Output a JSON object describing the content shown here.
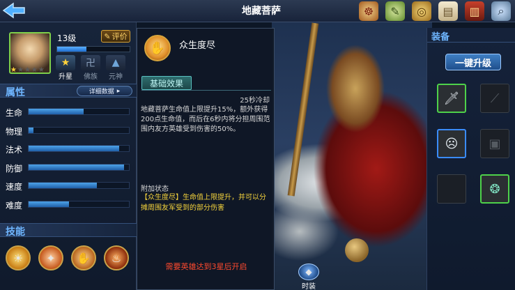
{
  "header": {
    "title": "地藏菩萨",
    "back_icon": "back-arrow-icon",
    "top_icons": [
      "mandala-icon",
      "scroll-icon",
      "coin-icon",
      "document-icon",
      "book-icon",
      "magnifier-icon"
    ]
  },
  "hero": {
    "level": "13级",
    "rate_label": "评价",
    "stars_filled": 1,
    "stars_total": 5,
    "exp_fraction": 0.4,
    "actions": [
      {
        "label": "升星",
        "icon": "star-icon"
      },
      {
        "label": "佛族",
        "icon": "swastika-icon"
      },
      {
        "label": "元神",
        "icon": "spirit-icon"
      }
    ]
  },
  "attributes": {
    "title": "属性",
    "details_label": "详细数据",
    "rows": [
      {
        "label": "生命",
        "value": 0.55
      },
      {
        "label": "物理",
        "value": 0.05
      },
      {
        "label": "法术",
        "value": 0.9
      },
      {
        "label": "防御",
        "value": 0.95
      },
      {
        "label": "速度",
        "value": 0.68
      },
      {
        "label": "难度",
        "value": 0.4
      }
    ]
  },
  "skills": {
    "title": "技能",
    "items": [
      "skill-1-icon",
      "skill-2-icon",
      "skill-3-icon",
      "skill-4-icon"
    ]
  },
  "skill_detail": {
    "name": "众生度尽",
    "tab_label": "基础效果",
    "cooldown": "25秒冷却",
    "description": "地藏菩萨生命值上限提升15%，额外获得200点生命值，而后在6秒内将分担周围范围内友方英雄受到伤害的50%。",
    "extra_title": "附加状态",
    "extra_text": "【众生度尽】生命值上限提升，并可以分摊周围友军受到的部分伤害",
    "unlock_hint": "需要英雄达到3星后开启"
  },
  "bottom_tab": {
    "label": "时装"
  },
  "equipment": {
    "title": "装备",
    "upgrade_label": "一键升级",
    "slots": [
      {
        "state": "green",
        "icon": "dagger-icon"
      },
      {
        "state": "empty",
        "icon": "blade-silhouette-icon"
      },
      {
        "state": "blue",
        "icon": "mask-icon"
      },
      {
        "state": "empty",
        "icon": "armor-silhouette-icon"
      },
      {
        "state": "empty",
        "icon": "empty-slot-icon"
      },
      {
        "state": "green",
        "icon": "amulet-icon"
      }
    ]
  },
  "colors": {
    "accent_blue": "#6fb6ff",
    "gold": "#d8a53c",
    "warning_red": "#ff4a2e",
    "extra_yellow": "#f3d23c"
  }
}
